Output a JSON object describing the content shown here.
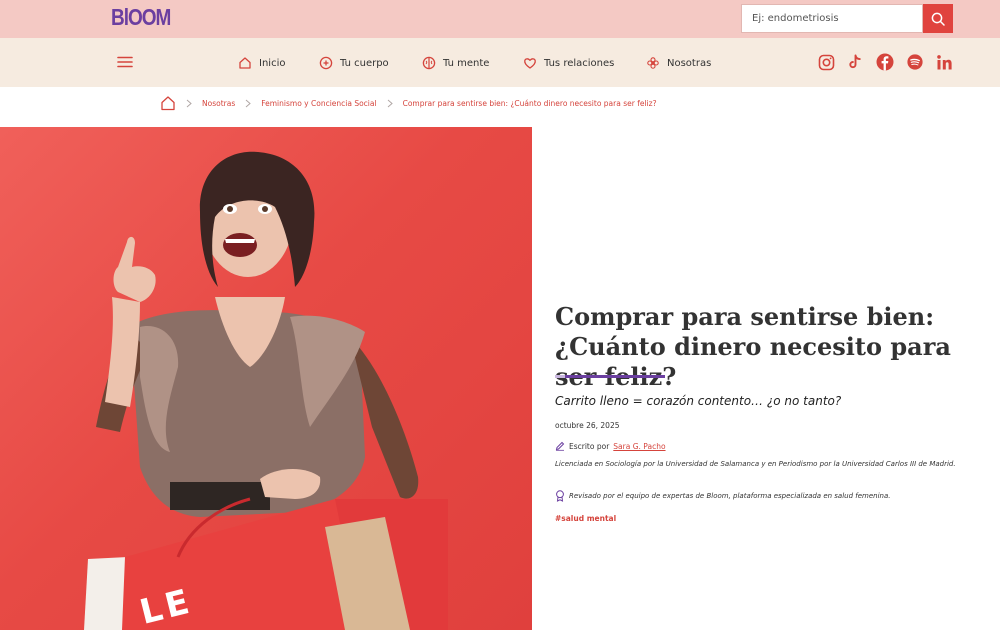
{
  "brand": {
    "logo_text": "BlOOM",
    "accent": "#e0433e",
    "purple": "#6b3fa0"
  },
  "search": {
    "placeholder": "Ej: endometriosis",
    "icon": "search-icon"
  },
  "nav": {
    "menu_icon": "hamburger-icon",
    "items": [
      {
        "label": "Inicio",
        "icon": "home-icon"
      },
      {
        "label": "Tu cuerpo",
        "icon": "circle-plus-icon"
      },
      {
        "label": "Tu mente",
        "icon": "brain-icon"
      },
      {
        "label": "Tus relaciones",
        "icon": "heart-icon"
      },
      {
        "label": "Nosotras",
        "icon": "flower-icon"
      }
    ],
    "social": [
      "instagram-icon",
      "tiktok-icon",
      "facebook-icon",
      "spotify-icon",
      "linkedin-icon"
    ]
  },
  "breadcrumb": {
    "items": [
      "Nosotras",
      "Feminismo y Conciencia Social",
      "Comprar para sentirse bien: ¿Cuánto dinero necesito para ser feliz?"
    ]
  },
  "article": {
    "title": "Comprar para sentirse bien: ¿Cuánto dinero necesito para ser feliz?",
    "subtitle": "Carrito lleno = corazón contento… ¿o no tanto?",
    "date": "octubre 26, 2025",
    "author_prefix": "Escrito por",
    "author_name": "Sara G. Pacho",
    "author_bio": "Licenciada en Sociología por la Universidad de Salamanca y en Periodismo por la Universidad Carlos III de Madrid.",
    "review_text": "Revisado por el equipo de expertas de Bloom, plataforma especializada en salud femenina.",
    "tag": "#salud mental",
    "hero_letters": "LE"
  }
}
